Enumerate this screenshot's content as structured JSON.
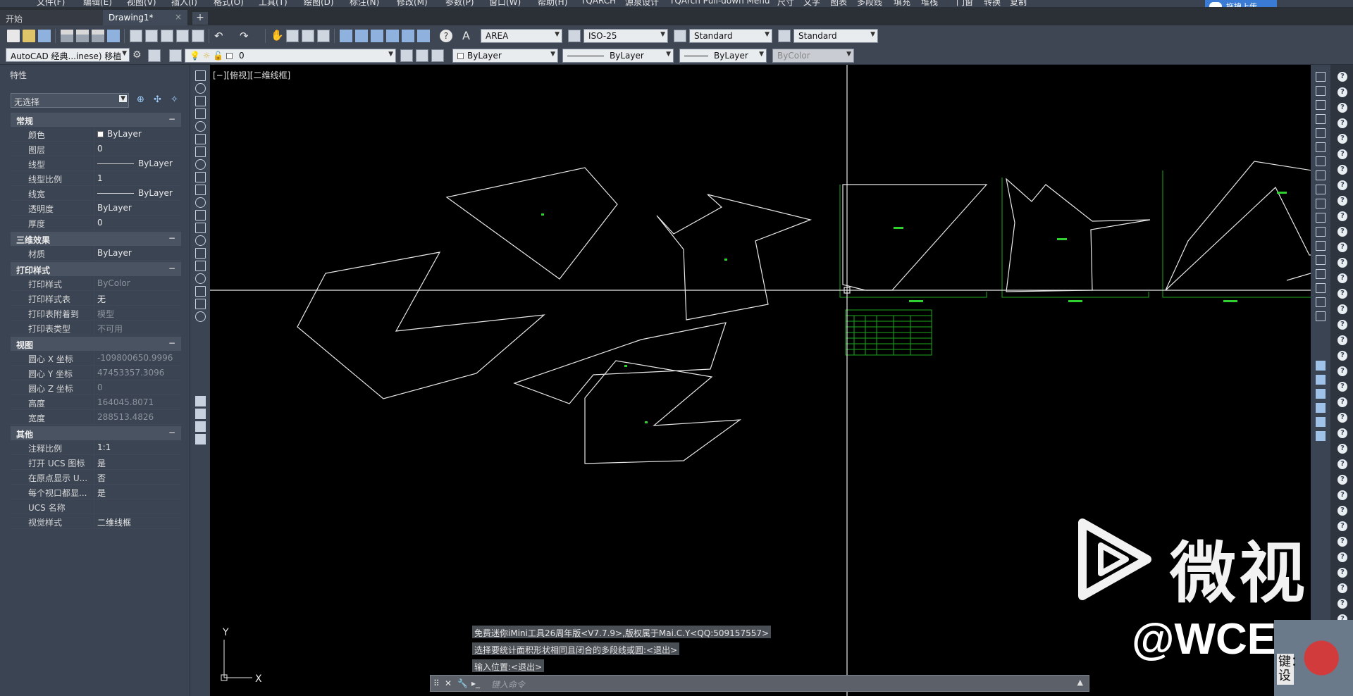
{
  "menu": {
    "items": [
      "文件(F)",
      "编辑(E)",
      "视图(V)",
      "插入(I)",
      "格式(O)",
      "工具(T)",
      "绘图(D)",
      "标注(N)",
      "修改(M)",
      "参数(P)",
      "窗口(W)",
      "帮助(H)",
      "TQARCH",
      "源泉设计",
      "TQArch Pull-down Menu",
      "尺寸",
      "文字",
      "图表",
      "多段线",
      "填充",
      "堆栈",
      "门窗",
      "转换",
      "复制"
    ],
    "upload_label": "拖拽上传"
  },
  "tabs": {
    "start": "开始",
    "drawing": "Drawing1*",
    "close": "×",
    "add": "+"
  },
  "toolbar": {
    "text_style": "AREA",
    "dim_style": "ISO-25",
    "table_style": "Standard",
    "multileader_style": "Standard",
    "workspace": "AutoCAD 经典...inese) 移植",
    "layer": "0",
    "color": "ByLayer",
    "linetype": "ByLayer",
    "lineweight": "ByLayer",
    "plotstyle": "ByColor",
    "help_glyph": "?"
  },
  "properties": {
    "title": "特性",
    "selection": "无选择",
    "sections": [
      {
        "name": "常规",
        "toggle": "−",
        "rows": [
          {
            "k": "颜色",
            "v": "ByLayer",
            "swatch": true
          },
          {
            "k": "图层",
            "v": "0"
          },
          {
            "k": "线型",
            "v": "ByLayer",
            "line": true
          },
          {
            "k": "线型比例",
            "v": "1"
          },
          {
            "k": "线宽",
            "v": "ByLayer",
            "line": true
          },
          {
            "k": "透明度",
            "v": "ByLayer"
          },
          {
            "k": "厚度",
            "v": "0"
          }
        ]
      },
      {
        "name": "三维效果",
        "toggle": "−",
        "rows": [
          {
            "k": "材质",
            "v": "ByLayer"
          }
        ]
      },
      {
        "name": "打印样式",
        "toggle": "−",
        "rows": [
          {
            "k": "打印样式",
            "v": "ByColor",
            "ro": true
          },
          {
            "k": "打印样式表",
            "v": "无"
          },
          {
            "k": "打印表附着到",
            "v": "模型",
            "ro": true
          },
          {
            "k": "打印表类型",
            "v": "不可用",
            "ro": true
          }
        ]
      },
      {
        "name": "视图",
        "toggle": "−",
        "rows": [
          {
            "k": "圆心 X 坐标",
            "v": "-109800650.9996",
            "ro": true
          },
          {
            "k": "圆心 Y 坐标",
            "v": "47453357.3096",
            "ro": true
          },
          {
            "k": "圆心 Z 坐标",
            "v": "0",
            "ro": true
          },
          {
            "k": "高度",
            "v": "164045.8071",
            "ro": true
          },
          {
            "k": "宽度",
            "v": "288513.4826",
            "ro": true
          }
        ]
      },
      {
        "name": "其他",
        "toggle": "−",
        "rows": [
          {
            "k": "注释比例",
            "v": "1:1"
          },
          {
            "k": "打开 UCS 图标",
            "v": "是"
          },
          {
            "k": "在原点显示 U...",
            "v": "否"
          },
          {
            "k": "每个视口都显...",
            "v": "是"
          },
          {
            "k": "UCS 名称",
            "v": ""
          },
          {
            "k": "视觉样式",
            "v": "二维线框"
          }
        ]
      }
    ]
  },
  "canvas": {
    "view_label": "[−][俯视][二维线框]",
    "axis_x": "X",
    "axis_y": "Y",
    "command_history": [
      "免费迷你iMini工具26周年版<V7.7.9>,版权属于Mai.C.Y<QQ:509157557>",
      "选择要统计面积形状相同且闭合的多段线或圆:<退出>",
      "输入位置:<退出>"
    ],
    "command_placeholder": "键入命令"
  },
  "watermark": {
    "brand": "微视",
    "handle": "@WCEO",
    "corner_text": "键：设"
  }
}
